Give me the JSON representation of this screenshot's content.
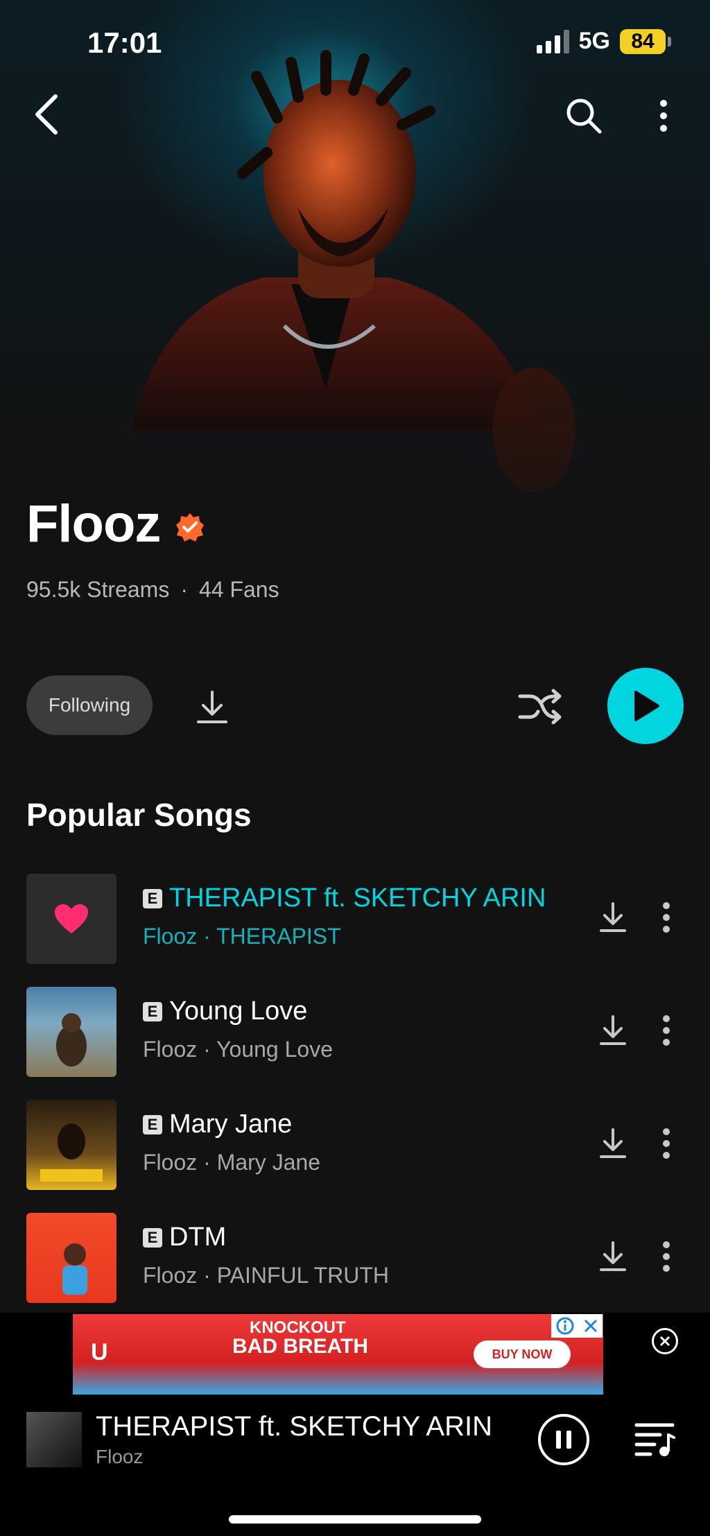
{
  "status_bar": {
    "time": "17:01",
    "network": "5G",
    "battery": "84"
  },
  "artist": {
    "name": "Flooz",
    "streams": "95.5k Streams",
    "separator": "·",
    "fans": "44 Fans"
  },
  "actions": {
    "follow_label": "Following"
  },
  "section": {
    "popular_title": "Popular Songs"
  },
  "songs": [
    {
      "explicit": "E",
      "title": "THERAPIST ft. SKETCHY ARIN",
      "subtitle": "Flooz · THERAPIST",
      "playing": true
    },
    {
      "explicit": "E",
      "title": "Young Love",
      "subtitle": "Flooz · Young Love",
      "playing": false
    },
    {
      "explicit": "E",
      "title": "Mary Jane",
      "subtitle": "Flooz · Mary Jane",
      "playing": false
    },
    {
      "explicit": "E",
      "title": "DTM",
      "subtitle": "Flooz · PAINFUL TRUTH",
      "playing": false
    }
  ],
  "ad": {
    "line1": "KNOCKOUT",
    "line2": "BAD BREATH",
    "cta": "BUY NOW",
    "brand": "U"
  },
  "now_playing": {
    "title": "THERAPIST ft. SKETCHY ARIN",
    "artist": "Flooz"
  },
  "colors": {
    "accent": "#00d5e0",
    "verified": "#ff6a2a",
    "heart": "#ff2e6e",
    "background": "#121212"
  },
  "icons": [
    "back-icon",
    "search-icon",
    "more-vertical-icon",
    "verified-badge-icon",
    "download-icon",
    "shuffle-icon",
    "play-icon",
    "heart-icon",
    "pause-icon",
    "queue-icon",
    "close-icon",
    "info-icon"
  ]
}
